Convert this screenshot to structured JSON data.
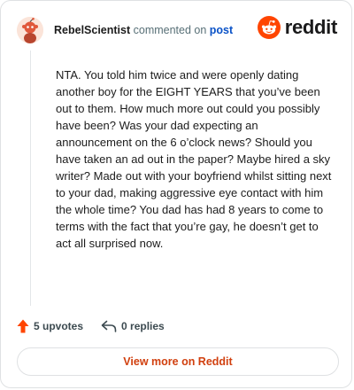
{
  "comment": {
    "username": "RebelScientist",
    "action_text": " commented on ",
    "link_text": "post",
    "body": "NTA. You told him twice and were openly dating another boy for the EIGHT YEARS that you’ve been out to them. How much more out could you possibly have been? Was your dad expecting an announcement on the 6 o’clock news? Should you have taken an ad out in the paper? Maybe hired a sky writer? Made out with your boyfriend whilst sitting next to your dad, making aggressive eye contact with him the whole time? You dad has had 8 years to come to terms with the fact that you’re gay, he doesn’t get to act all surprised now."
  },
  "brand": {
    "wordmark": "reddit",
    "icon": "reddit-alien-icon",
    "color": "#ff4500"
  },
  "actions": {
    "upvotes_label": "5 upvotes",
    "upvote_icon": "upvote-arrow-icon",
    "upvote_color": "#ff4500",
    "replies_label": "0 replies",
    "reply_icon": "reply-arrow-icon"
  },
  "footer": {
    "view_more_label": "View more on Reddit",
    "accent_color": "#d1400f"
  }
}
